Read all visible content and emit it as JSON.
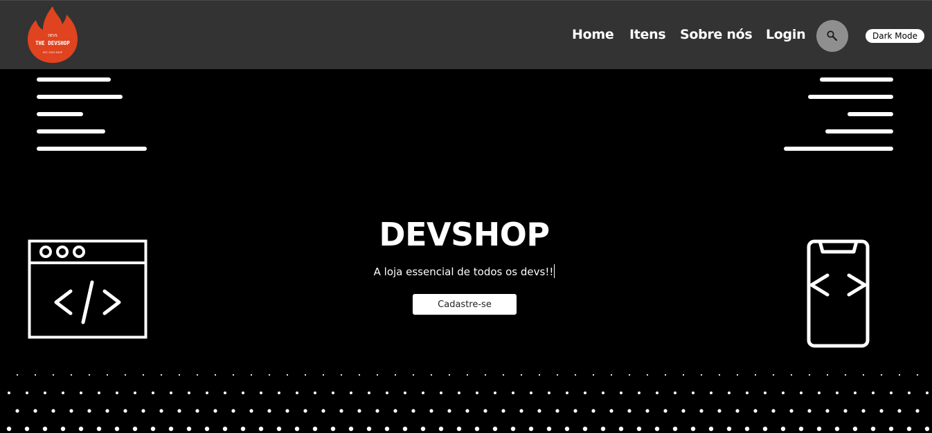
{
  "header": {
    "logo": {
      "brand_text": "THE DEVSHOP",
      "small_top_text": "DEVS",
      "small_bottom_text": "EST. 2022 SHOP",
      "flame_color": "#e0431f"
    },
    "nav": [
      {
        "label": "Home"
      },
      {
        "label": "Itens"
      },
      {
        "label": "Sobre nós"
      },
      {
        "label": "Login"
      }
    ],
    "search_icon": "search-icon",
    "dark_mode_label": "Dark Mode",
    "background_color": "#333333"
  },
  "hero": {
    "title": "DEVSHOP",
    "subtitle": "A loja essencial de todos os devs!!",
    "cta_label": "Cadastre-se",
    "background_color": "#000000",
    "icons": [
      "text-lines-left-icon",
      "text-lines-right-icon",
      "browser-code-icon",
      "mobile-code-icon"
    ]
  }
}
